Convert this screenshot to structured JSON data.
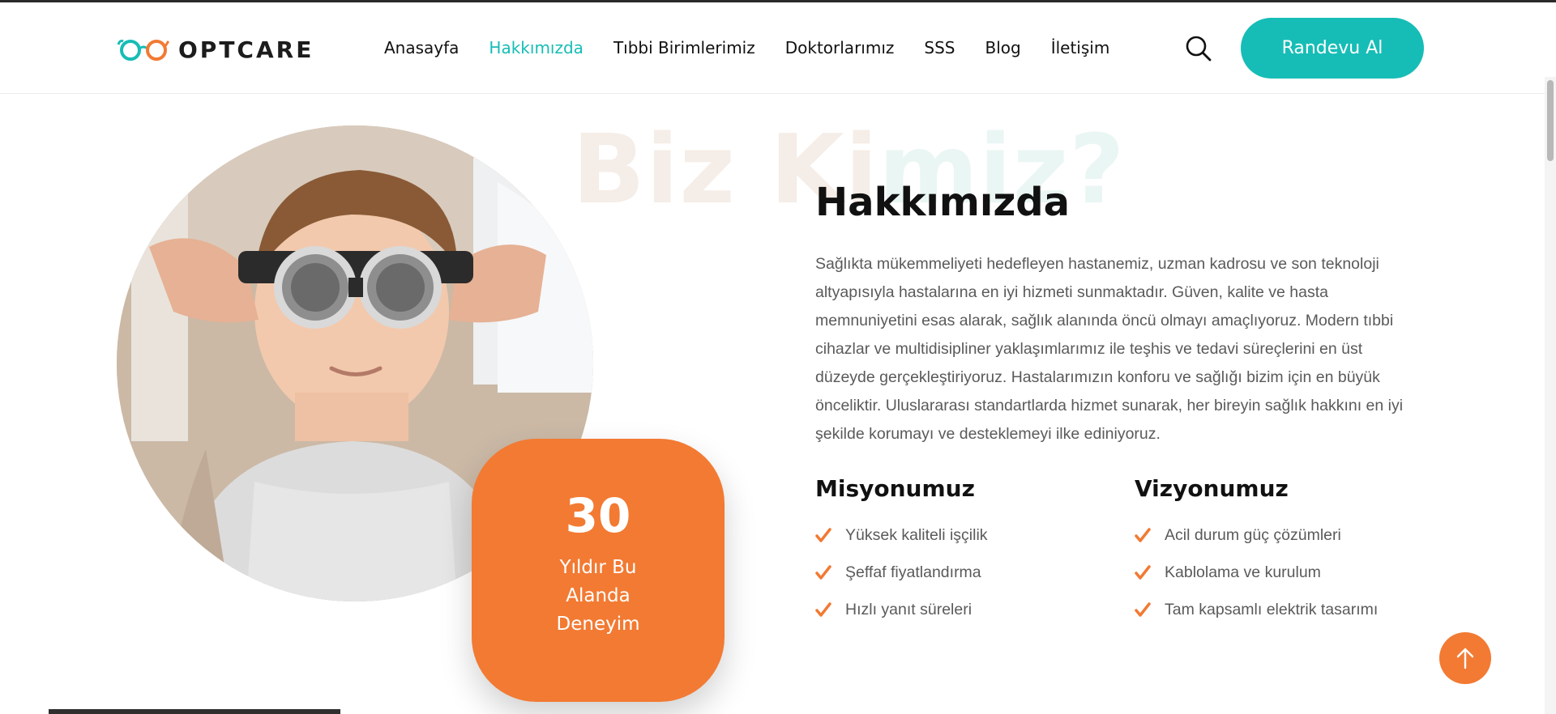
{
  "brand": {
    "name": "OPTCARE",
    "teal": "#16bdb6",
    "orange": "#f27a33"
  },
  "nav": {
    "items": [
      {
        "label": "Anasayfa",
        "active": false
      },
      {
        "label": "Hakkımızda",
        "active": true
      },
      {
        "label": "Tıbbi Birimlerimiz",
        "active": false
      },
      {
        "label": "Doktorlarımız",
        "active": false
      },
      {
        "label": "SSS",
        "active": false
      },
      {
        "label": "Blog",
        "active": false
      },
      {
        "label": "İletişim",
        "active": false
      }
    ],
    "search_icon": "search-icon",
    "cta_label": "Randevu Al"
  },
  "about": {
    "watermark_part1": "Biz Ki",
    "watermark_part2": "miz?",
    "title": "Hakkımızda",
    "body": "Sağlıkta mükemmeliyeti hedefleyen hastanemiz, uzman kadrosu ve son teknoloji altyapısıyla hastalarına en iyi hizmeti sunmaktadır. Güven, kalite ve hasta memnuniyetini esas alarak, sağlık alanında öncü olmayı amaçlıyoruz. Modern tıbbi cihazlar ve multidisipliner yaklaşımlarımız ile teşhis ve tedavi süreçlerini en üst düzeyde gerçekleştiriyoruz. Hastalarımızın konforu ve sağlığı bizim için en büyük önceliktir. Uluslararası standartlarda hizmet sunarak, her bireyin sağlık hakkını en iyi şekilde korumayı ve desteklemeyi ilke ediniyoruz.",
    "mission": {
      "title": "Misyonumuz",
      "items": [
        "Yüksek kaliteli işçilik",
        "Şeffaf fiyatlandırma",
        "Hızlı yanıt süreleri"
      ]
    },
    "vision": {
      "title": "Vizyonumuz",
      "items": [
        "Acil durum güç çözümleri",
        "Kablolama ve kurulum",
        "Tam kapsamlı elektrik tasarımı"
      ]
    }
  },
  "experience": {
    "number": "30",
    "label": "Yıldır Bu Alanda Deneyim"
  },
  "scroll_top_icon": "arrow-up-icon"
}
